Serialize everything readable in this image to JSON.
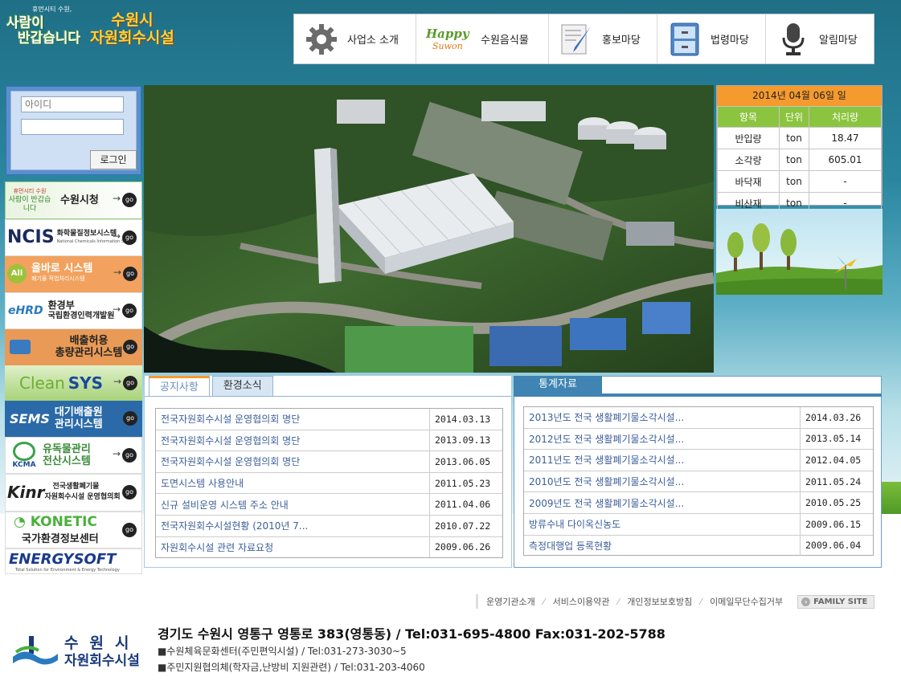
{
  "logo": {
    "city_small": "휴먼시티 수원,",
    "slogan_line1": "사람이",
    "slogan_line2": "반갑습니다",
    "org_line1": "수원시",
    "org_line2": "자원회수시설"
  },
  "topnav": [
    {
      "label": "사업소 소개",
      "icon": "gear-icon"
    },
    {
      "label": "수원음식물",
      "icon": "happy-suwon-logo",
      "logo_word1": "Happy",
      "logo_word2": "Suwon"
    },
    {
      "label": "홍보마당",
      "icon": "pen-paper-icon"
    },
    {
      "label": "법령마당",
      "icon": "cabinet-icon"
    },
    {
      "label": "알림마당",
      "icon": "microphone-icon"
    }
  ],
  "login": {
    "id_placeholder": "아이디",
    "pw_placeholder": "",
    "button": "로그인"
  },
  "banners": [
    {
      "small": "휴먼시티 수원",
      "logo_text": "사람이 반갑습니다",
      "text": "수원시청",
      "go": "go"
    },
    {
      "logo_text": "NCIS",
      "text": "화학물질정보시스템",
      "small": "National Chemicals Information System",
      "go": "go"
    },
    {
      "logo_text": "All",
      "text": "올바로 시스템",
      "small": "폐기물 적법처리시스템",
      "go": "go"
    },
    {
      "logo_text": "eHRD",
      "text": "환경부",
      "small": "국립환경인력개발원",
      "go": "go"
    },
    {
      "text": "배출허용",
      "text2": "총량관리시스템",
      "go": "go"
    },
    {
      "text": "Clean",
      "text2": "SYS",
      "go": "go"
    },
    {
      "logo_text": "SEMS",
      "text": "대기배출원",
      "text2": "관리시스템",
      "go": "go"
    },
    {
      "logo_text": "KCMA",
      "text": "유독물관리",
      "text2": "전산시스템",
      "go": "go"
    },
    {
      "logo_text": "Kinr",
      "text": "전국생활폐기물",
      "text2": "자원회수시설 운영협의회",
      "go": "go"
    },
    {
      "logo_text": "KONETIC",
      "text": "국가환경정보센터",
      "go": "go"
    },
    {
      "logo_text": "ENERGYSOFT",
      "small": "Total Solution for Environment & Energy Technology"
    }
  ],
  "stats": {
    "date": "2014년 04월 06일 일",
    "headers": [
      "항목",
      "단위",
      "처리량"
    ],
    "rows": [
      [
        "반입량",
        "ton",
        "18.47"
      ],
      [
        "소각량",
        "ton",
        "605.01"
      ],
      [
        "바닥재",
        "ton",
        "-"
      ],
      [
        "비산재",
        "ton",
        "-"
      ]
    ]
  },
  "notice": {
    "tabs": [
      "공지사항",
      "환경소식"
    ],
    "items": [
      [
        "전국자원회수시설 운영협의회 명단",
        "2014.03.13"
      ],
      [
        "전국자원회수시설 운영협의회 명단",
        "2013.09.13"
      ],
      [
        "전국자원회수시설 운영협의회 명단",
        "2013.06.05"
      ],
      [
        "도면시스템 사용안내",
        "2011.05.23"
      ],
      [
        "신규 설비운영 시스템 주소 안내",
        "2011.04.06"
      ],
      [
        "전국자원회수시설현황 (2010년 7...",
        "2010.07.22"
      ],
      [
        "자원회수시설 관련 자료요청",
        "2009.06.26"
      ]
    ]
  },
  "statistics": {
    "title": "통계자료",
    "items": [
      [
        "2013년도 전국 생활폐기물소각시설...",
        "2014.03.26"
      ],
      [
        "2012년도 전국 생활폐기물소각시설...",
        "2013.05.14"
      ],
      [
        "2011년도 전국 생활폐기물소각시설...",
        "2012.04.05"
      ],
      [
        "2010년도 전국 생활폐기물소각시설...",
        "2011.05.24"
      ],
      [
        "2009년도 전국 생활폐기물소각시설...",
        "2010.05.25"
      ],
      [
        "방류수내 다이옥신농도",
        "2009.06.15"
      ],
      [
        "측정대행업 등록현황",
        "2009.06.04"
      ]
    ]
  },
  "footer": {
    "links": [
      "운영기관소개",
      "서비스이용약관",
      "개인정보보호방침",
      "이메일무단수집거부"
    ],
    "family": "FAMILY SITE",
    "logo_line1": "수원시",
    "logo_line2": "자원회수시설",
    "address": "경기도 수원시 영통구 영통로 383(영통동) / Tel:031-695-4800 Fax:031-202-5788",
    "sub1": "■수원체육문화센터(주민편익시설) / Tel:031-273-3030~5",
    "sub2": "■주민지원협의체(학자금,난방비 지원관련) / Tel:031-203-4060"
  },
  "colors": {
    "accent_orange": "#f59a2e",
    "accent_green": "#8bc53f",
    "link_blue": "#3c5f9a",
    "header_blue": "#3f84b2"
  }
}
